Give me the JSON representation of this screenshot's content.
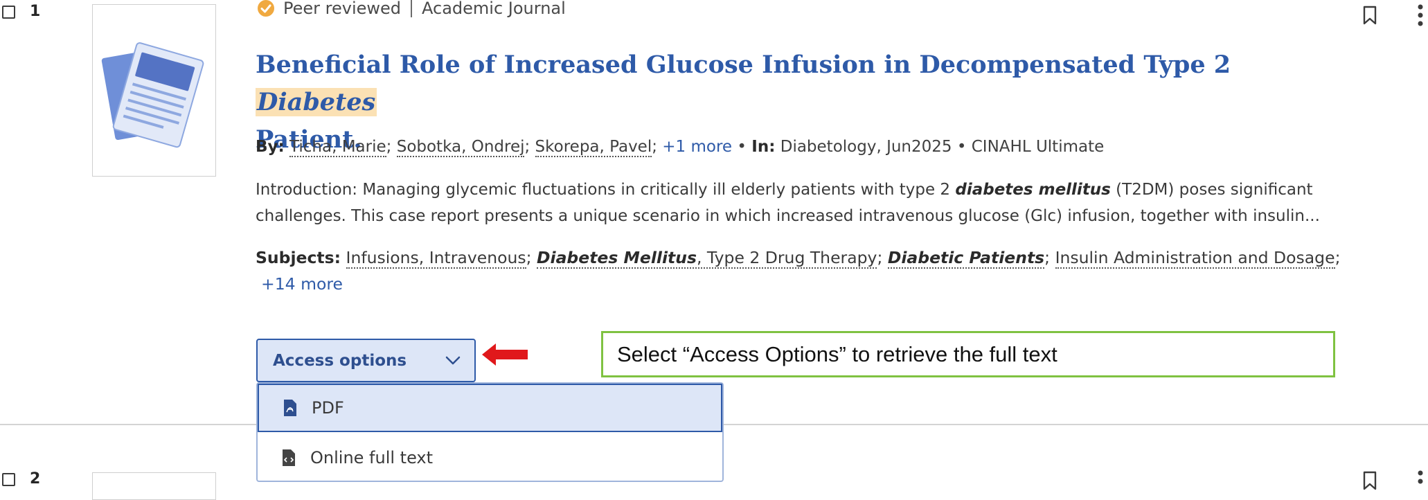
{
  "results": [
    {
      "number": "1",
      "peer_reviewed": "Peer reviewed",
      "source_type": "Academic Journal",
      "title_before": "Beneficial Role of Increased Glucose Infusion in Decompensated Type 2 ",
      "title_highlight": "Diabetes",
      "title_after": "Patient.",
      "by_label": "By:",
      "authors": [
        "Ticha, Marie",
        "Sobotka, Ondrej",
        "Skorepa, Pavel"
      ],
      "more_authors": "+1 more",
      "in_label": "In:",
      "publication": "Diabetology, Jun2025",
      "database": "CINAHL Ultimate",
      "abstract": {
        "part1": "Introduction: Managing glycemic fluctuations in critically ill elderly patients with type 2 ",
        "bold": "diabetes mellitus",
        "part2": " (T2DM) poses significant",
        "line2": "challenges. This case report presents a unique scenario in which increased intravenous glucose (Glc) infusion, together with insulin..."
      },
      "subjects_label": "Subjects:",
      "subjects": {
        "s1": "Infusions, Intravenous",
        "s2_bold": "Diabetes Mellitus",
        "s2_rest": ", Type 2 Drug Therapy",
        "s3_bold": "Diabetic Patients",
        "s4": "Insulin Administration and Dosage"
      },
      "more_subjects": "+14 more",
      "access_button": "Access options",
      "access_menu": [
        "PDF",
        "Online full text"
      ]
    },
    {
      "number": "2"
    }
  ],
  "callout_text": "Select “Access Options” to retrieve the full text",
  "icons": {
    "peer_reviewed": "check-badge-icon",
    "bookmark": "bookmark-icon",
    "more": "vertical-ellipsis-icon",
    "pdf": "pdf-file-icon",
    "html": "code-file-icon",
    "chevron": "chevron-down-icon",
    "arrow": "red-arrow-left-icon"
  },
  "colors": {
    "accent": "#2e5aa8",
    "highlight": "#fbe1b4",
    "badge": "#f0a940",
    "callout_border": "#7fc241",
    "arrow": "#e0181b"
  }
}
